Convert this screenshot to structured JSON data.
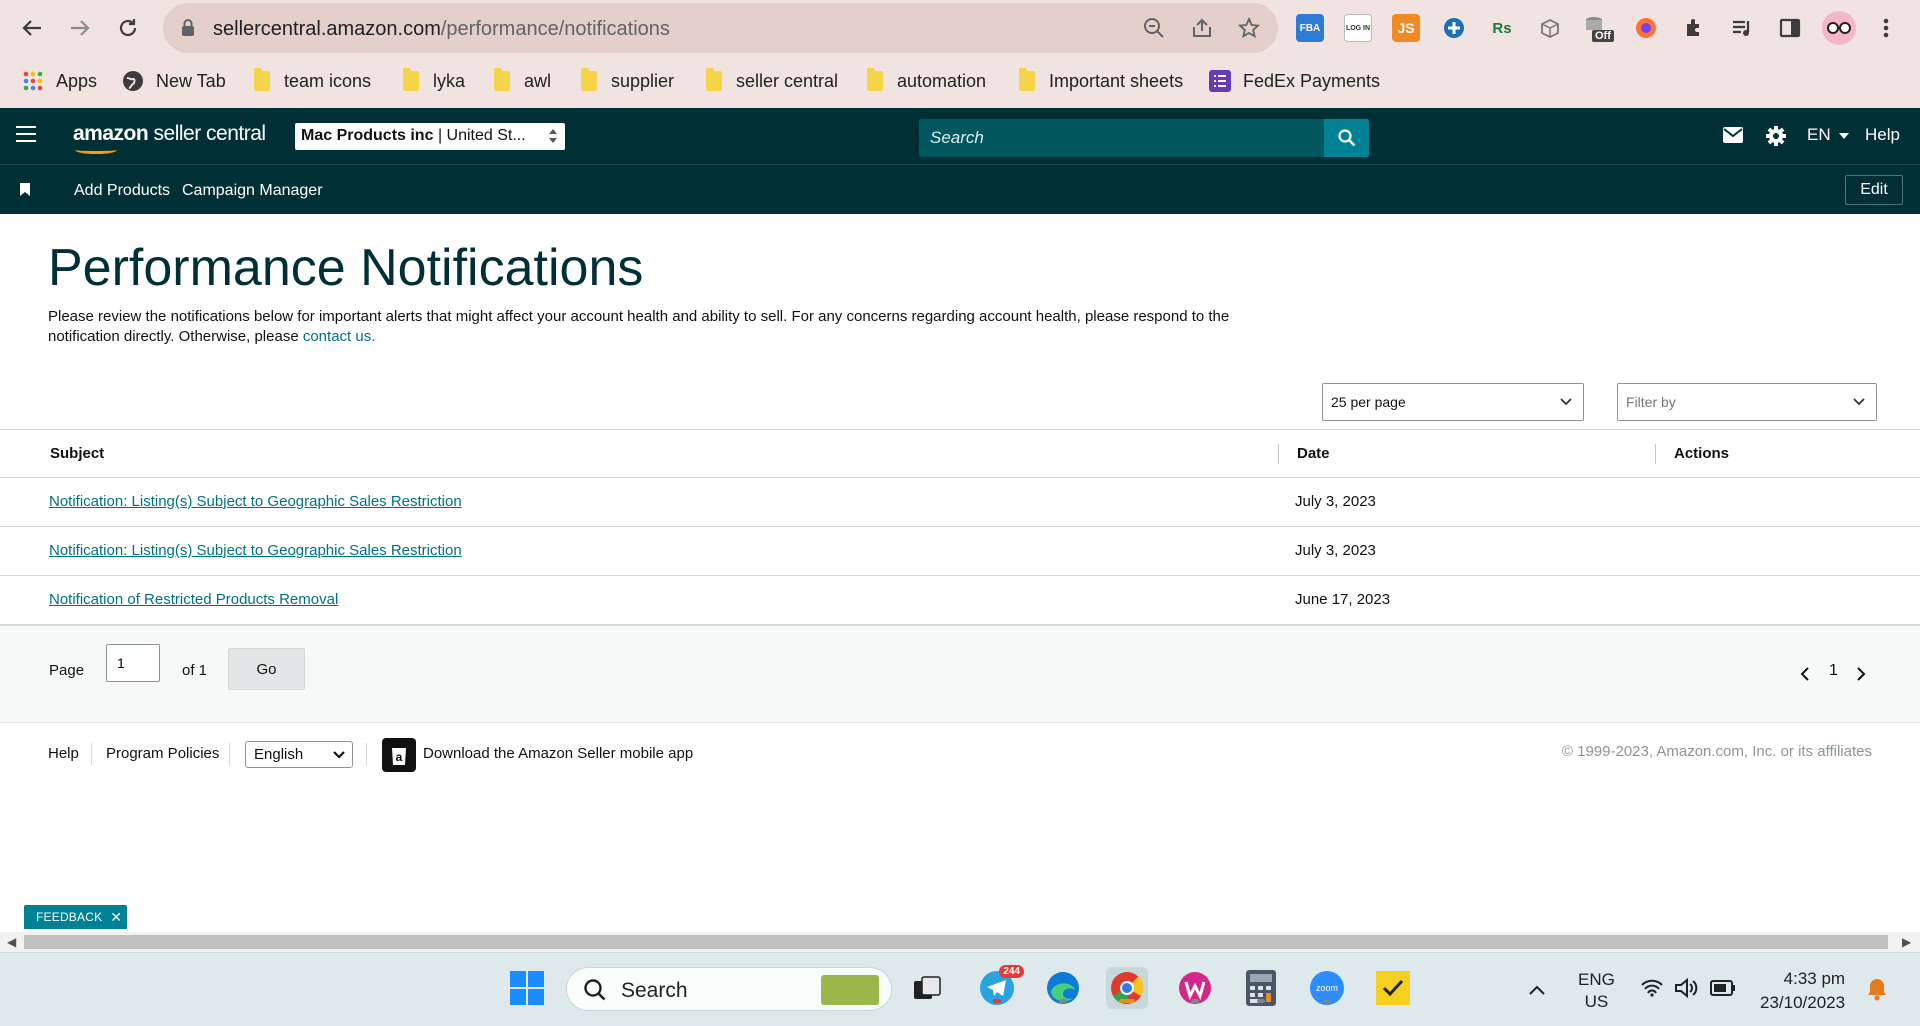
{
  "browser": {
    "url_host": "sellercentral.amazon.com",
    "url_path": "/performance/notifications",
    "bookmarks": [
      {
        "label": "Apps",
        "icon": "apps-grid-icon"
      },
      {
        "label": "New Tab",
        "icon": "globe-icon"
      },
      {
        "label": "team icons",
        "icon": "folder-icon"
      },
      {
        "label": "lyka",
        "icon": "folder-icon"
      },
      {
        "label": "awl",
        "icon": "folder-icon"
      },
      {
        "label": "supplier",
        "icon": "folder-icon"
      },
      {
        "label": "seller central",
        "icon": "folder-icon"
      },
      {
        "label": "automation",
        "icon": "folder-icon"
      },
      {
        "label": "Important sheets",
        "icon": "folder-icon"
      },
      {
        "label": "FedEx Payments",
        "icon": "list-icon"
      }
    ],
    "extensions": {
      "fba": "FBA",
      "login": "LOG IN",
      "js": "JS",
      "rs": "Rs",
      "off": "Off"
    }
  },
  "header": {
    "logo_bold": "amazon",
    "logo_rest": " seller central",
    "account_name": "Mac Products inc",
    "account_region": "United St...",
    "search_placeholder": "Search",
    "language": "EN",
    "help": "Help"
  },
  "subnav": {
    "links": [
      "Add Products",
      "Campaign Manager"
    ],
    "edit": "Edit"
  },
  "page": {
    "title": "Performance Notifications",
    "intro": "Please review the notifications below for important alerts that might affect your account health and ability to sell. For any concerns regarding account health, please respond to the notification directly. Otherwise, please ",
    "contact_link": "contact us.",
    "per_page": "25 per page",
    "filter_placeholder": "Filter by"
  },
  "table": {
    "columns": [
      "Subject",
      "Date",
      "Actions"
    ],
    "rows": [
      {
        "subject": "Notification: Listing(s) Subject to Geographic Sales Restriction",
        "date": "July 3, 2023"
      },
      {
        "subject": "Notification: Listing(s) Subject to Geographic Sales Restriction",
        "date": "July 3, 2023"
      },
      {
        "subject": "Notification of Restricted Products Removal",
        "date": "June 17, 2023"
      }
    ]
  },
  "pagination": {
    "page_label": "Page",
    "page_value": "1",
    "of_label": "of 1",
    "go": "Go",
    "current": "1"
  },
  "footer": {
    "help": "Help",
    "policies": "Program Policies",
    "language": "English",
    "app_link": "Download the Amazon Seller mobile app",
    "copyright": "© 1999-2023, Amazon.com, Inc. or its affiliates"
  },
  "feedback": "FEEDBACK",
  "taskbar": {
    "search": "Search",
    "telegram_badge": "244",
    "lang_line1": "ENG",
    "lang_line2": "US",
    "time": "4:33 pm",
    "date": "23/10/2023"
  },
  "colors": {
    "header_bg": "#002f36",
    "link": "#007185",
    "accent": "#008296"
  }
}
